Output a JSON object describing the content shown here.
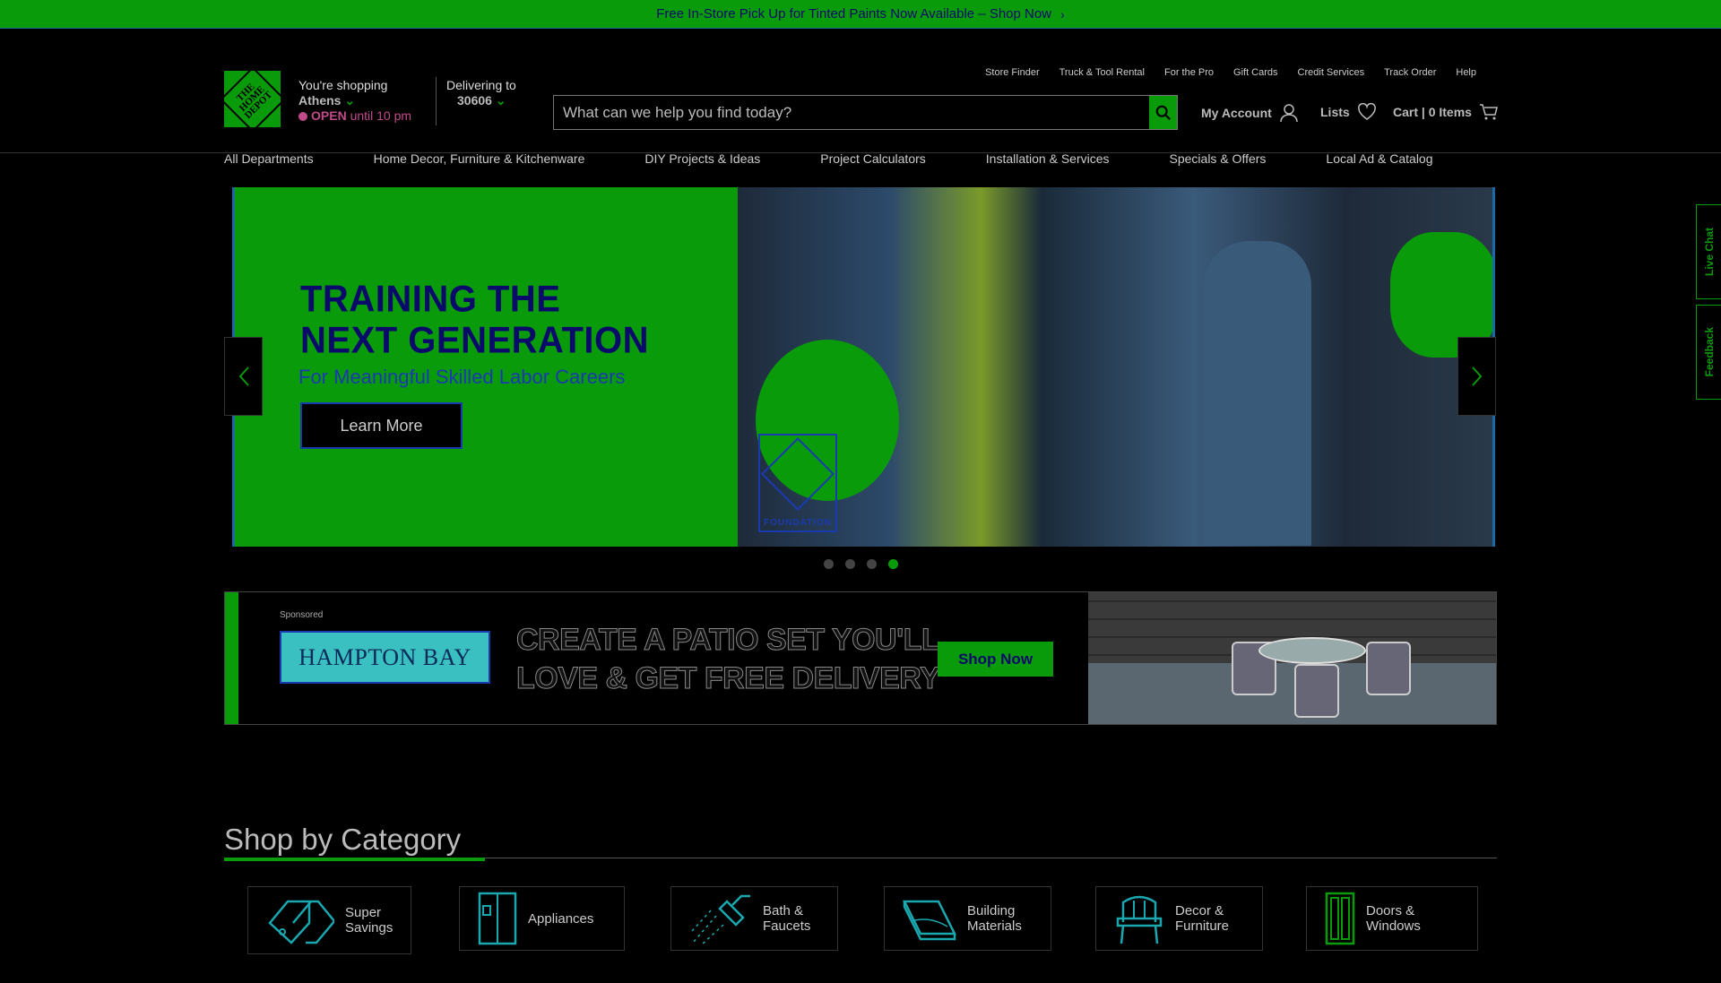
{
  "promo_bar": {
    "text": "Free In-Store Pick Up for Tinted Paints Now Available – Shop Now"
  },
  "logo": {
    "text": "THE HOME DEPOT"
  },
  "store": {
    "label": "You're shopping",
    "city": "Athens",
    "status": "OPEN",
    "hours": "until 10 pm"
  },
  "delivery": {
    "label": "Delivering to",
    "zip": "30606"
  },
  "utility_links": [
    "Store Finder",
    "Truck & Tool Rental",
    "For the Pro",
    "Gift Cards",
    "Credit Services",
    "Track Order",
    "Help"
  ],
  "search": {
    "placeholder": "What can we help you find today?"
  },
  "account": {
    "my_account": "My Account",
    "lists": "Lists",
    "cart": "Cart | 0 Items"
  },
  "nav": [
    "All Departments",
    "Home Decor, Furniture & Kitchenware",
    "DIY Projects & Ideas",
    "Project Calculators",
    "Installation & Services",
    "Specials & Offers",
    "Local Ad & Catalog"
  ],
  "hero": {
    "title_line1": "TRAINING THE",
    "title_line2": "NEXT GENERATION",
    "subtitle": "For Meaningful Skilled Labor Careers",
    "cta": "Learn More",
    "foundation_label": "FOUNDATION",
    "slides": 4,
    "active_slide": 4
  },
  "sponsored": {
    "label": "Sponsored",
    "brand": "HAMPTON BAY",
    "headline_line1": "CREATE A PATIO SET YOU'LL",
    "headline_line2": "LOVE & GET FREE DELIVERY",
    "cta": "Shop Now"
  },
  "categories_section": {
    "title": "Shop by Category",
    "items": [
      {
        "line1": "Super",
        "line2": "Savings",
        "icon": "tag-icon"
      },
      {
        "line1": "Appliances",
        "line2": "",
        "icon": "refrigerator-icon"
      },
      {
        "line1": "Bath &",
        "line2": "Faucets",
        "icon": "shower-icon"
      },
      {
        "line1": "Building",
        "line2": "Materials",
        "icon": "lumber-icon"
      },
      {
        "line1": "Decor &",
        "line2": "Furniture",
        "icon": "chair-icon"
      },
      {
        "line1": "Doors &",
        "line2": "Windows",
        "icon": "door-icon"
      }
    ]
  },
  "side_tabs": {
    "live_chat": "Live Chat",
    "feedback": "Feedback"
  },
  "colors": {
    "brand_green": "#0a9b0a",
    "background": "#000000",
    "status_magenta": "#c04a8a"
  }
}
